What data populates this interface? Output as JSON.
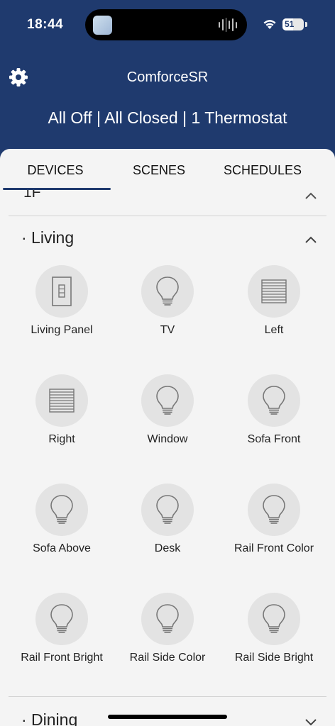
{
  "status_bar": {
    "time": "18:44",
    "battery": "51",
    "battery_level": 0.51
  },
  "header": {
    "app_title": "ComforceSR",
    "summary": "All Off | All Closed | 1 Thermostat"
  },
  "tabs": [
    {
      "label": "DEVICES",
      "active": true
    },
    {
      "label": "SCENES",
      "active": false
    },
    {
      "label": "SCHEDULES",
      "active": false
    }
  ],
  "previous_section": {
    "label": "1F"
  },
  "sections": [
    {
      "label": "· Living",
      "expanded": true,
      "devices": [
        {
          "label": "Living Panel",
          "icon": "panel-switch-icon"
        },
        {
          "label": "TV",
          "icon": "light-bulb-icon"
        },
        {
          "label": "Left",
          "icon": "blinds-icon"
        },
        {
          "label": "Right",
          "icon": "blinds-icon"
        },
        {
          "label": "Window",
          "icon": "light-bulb-icon"
        },
        {
          "label": "Sofa Front",
          "icon": "light-bulb-icon"
        },
        {
          "label": "Sofa Above",
          "icon": "light-bulb-icon"
        },
        {
          "label": "Desk",
          "icon": "light-bulb-icon"
        },
        {
          "label": "Rail Front Color",
          "icon": "light-bulb-icon"
        },
        {
          "label": "Rail Front Bright",
          "icon": "light-bulb-icon"
        },
        {
          "label": "Rail Side Color",
          "icon": "light-bulb-icon"
        },
        {
          "label": "Rail Side Bright",
          "icon": "light-bulb-icon"
        }
      ]
    },
    {
      "label": "· Dining",
      "expanded": false,
      "devices": []
    }
  ],
  "colors": {
    "header_bg": "#1f3a6e",
    "sheet_bg": "#f4f4f4",
    "icon_circle": "#e3e3e3",
    "accent": "#1f3a6e"
  }
}
